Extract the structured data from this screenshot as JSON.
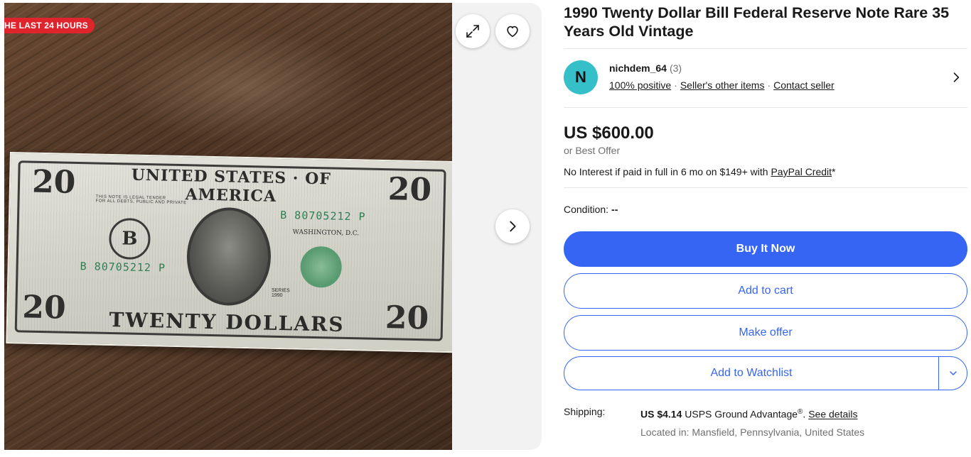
{
  "gallery": {
    "badge": "HE LAST 24 HOURS",
    "icons": {
      "expand": "expand-icon",
      "watch": "heart-icon",
      "next": "chevron-right-icon"
    }
  },
  "listing": {
    "title": "1990 Twenty Dollar Bill Federal Reserve Note Rare 35 Years Old Vintage"
  },
  "seller": {
    "initial": "N",
    "name": "nichdem_64",
    "feedback_count": "(3)",
    "positive": "100% positive",
    "other_items": "Seller's other items",
    "contact": "Contact seller",
    "avatar_color": "#34bfc9"
  },
  "pricing": {
    "price": "US $600.00",
    "best_offer": "or Best Offer",
    "financing_text": "No Interest if paid in full in 6 mo on $149+ with ",
    "financing_link": "PayPal Credit",
    "financing_suffix": "*"
  },
  "condition": {
    "label": "Condition:",
    "value": "--"
  },
  "actions": {
    "buy_now": "Buy It Now",
    "add_to_cart": "Add to cart",
    "make_offer": "Make offer",
    "watchlist": "Add to Watchlist"
  },
  "shipping": {
    "label": "Shipping:",
    "cost": "US $4.14",
    "service": " USPS Ground Advantage",
    "registered": "®",
    "period": ". ",
    "details_link": "See details",
    "location": "Located in: Mansfield, Pennsylvania, United States"
  },
  "colors": {
    "primary": "#3665f3",
    "badge": "#e0242c"
  }
}
